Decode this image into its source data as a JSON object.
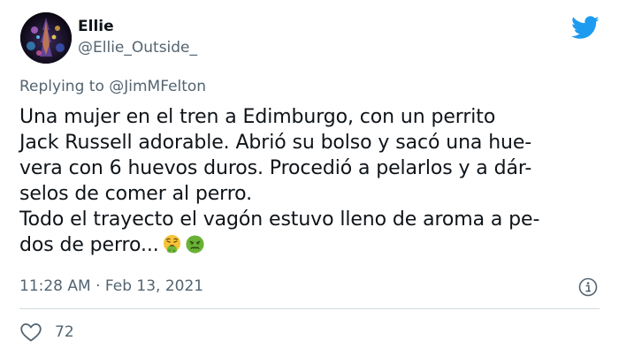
{
  "author": {
    "name": "Ellie",
    "handle": "@Ellie_Outside_"
  },
  "reply": {
    "prefix": "Replying to ",
    "handle": "@JimMFelton"
  },
  "tweet": {
    "lines": [
      "Una mujer en el tren a Edimburgo, con un perrito",
      "Jack Russell adorable. Abrió su bolso y sacó una hue-",
      "vera con 6 huevos duros. Procedió a pelarlos y a dár-",
      "selos de comer al perro.",
      "Todo el trayecto el vagón estuvo lleno de aroma a pe-",
      "dos de perro..."
    ],
    "emojis": [
      "face-vomiting-icon",
      "nauseated-face-icon"
    ]
  },
  "meta": {
    "timestamp": "11:28 AM · Feb 13, 2021"
  },
  "engagement": {
    "likes": "72"
  },
  "colors": {
    "twitter_blue": "#1d9bf0",
    "secondary_text": "#536471",
    "divider": "#cfd9de"
  }
}
